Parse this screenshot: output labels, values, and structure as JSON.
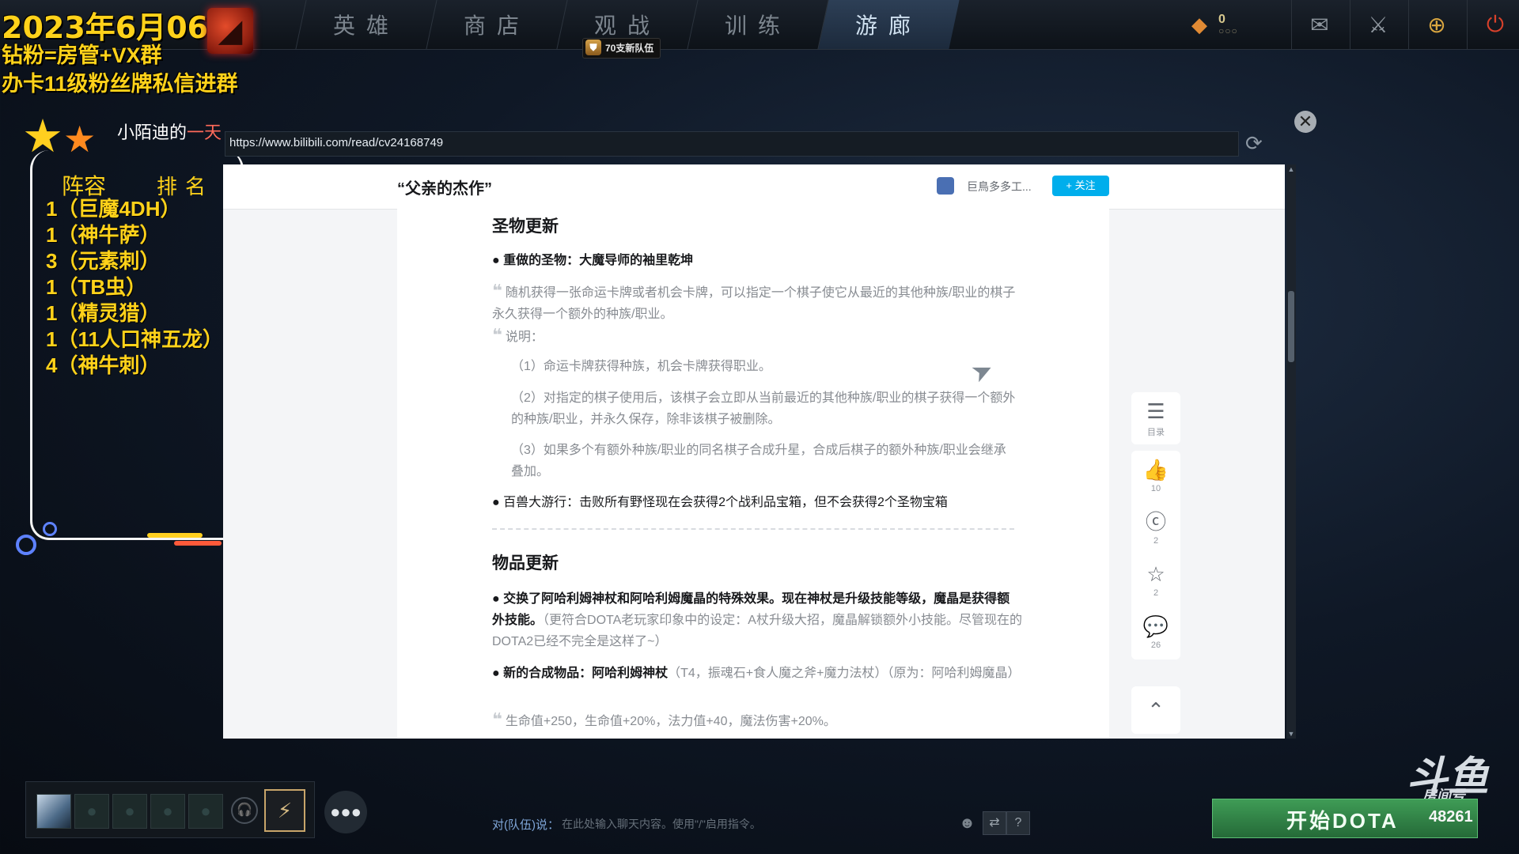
{
  "nav": {
    "tabs": [
      "英雄",
      "商店",
      "观战",
      "训练",
      "游廊"
    ],
    "active_tab": "游廊",
    "team_badge": "70支新队伍",
    "shards_count": "0",
    "shards_dots": "○○○"
  },
  "overlay": {
    "date": "2023年6月06",
    "line1": "钻粉=房管+VX群",
    "line2": "办卡11级粉丝牌私信进群",
    "streamer_prefix": "小陌迪的",
    "streamer_suffix": "一天",
    "lineup_header": "阵容",
    "rank_header": "排名",
    "lineup": [
      "1（巨魔4DH）",
      "1（神牛萨）",
      "3（元素刺）",
      "1（TB虫）",
      "1（精灵猎）",
      "1（11人口神五龙）",
      "4（神牛刺）"
    ]
  },
  "browser": {
    "url": "https://www.bilibili.com/read/cv24168749",
    "page_title": "“父亲的杰作”",
    "author": "巨鳥多多工...",
    "follow_label": "+ 关注"
  },
  "article": {
    "h1": "圣物更新",
    "p1": "● 重做的圣物：大魔导师的袖里乾坤",
    "q1": "随机获得一张命运卡牌或者机会卡牌，可以指定一个棋子使它从最近的其他种族/职业的棋子永久获得一个额外的种族/职业。",
    "q2": "说明：",
    "n1": "（1）命运卡牌获得种族，机会卡牌获得职业。",
    "n2": "（2）对指定的棋子使用后，该棋子会立即从当前最近的其他种族/职业的棋子获得一个额外的种族/职业，并永久保存，除非该棋子被删除。",
    "n3": "（3）如果多个有额外种族/职业的同名棋子合成升星，合成后棋子的额外种族/职业会继承叠加。",
    "p2": "● 百兽大游行：击败所有野怪现在会获得2个战利品宝箱，但不会获得2个圣物宝箱",
    "h2": "物品更新",
    "p3_bold": "● 交换了阿哈利姆神杖和阿哈利姆魔晶的特殊效果。现在神杖是升级技能等级，魔晶是获得额外技能。",
    "p3_note": "（更符合DOTA老玩家印象中的设定：A杖升级大招，魔晶解锁额外小技能。尽管现在的DOTA2已经不完全是这样了~）",
    "p4_bold": "● 新的合成物品：阿哈利姆神杖",
    "p4_rest": "（T4，振魂石+食人魔之斧+魔力法杖）（原为：阿哈利姆魔晶）",
    "q3": "生命值+250，生命值+20%，法力值+40，魔法伤害+20%。"
  },
  "sidebar_tools": {
    "toc_label": "目录",
    "likes": "10",
    "coins": "2",
    "favorites": "2",
    "comments": "26"
  },
  "bottom": {
    "chat_label": "对(队伍)说：",
    "chat_placeholder": "在此处输入聊天内容。使用\"/\"启用指令。",
    "help": "?",
    "play_label": "开始DOTA",
    "room_number": "48261",
    "douyu_logo": "斗鱼",
    "douyu_sub": "房间号"
  },
  "colors": {
    "accent_yellow": "#ffd21a",
    "bili_blue": "#00aeec",
    "play_green": "#3f9c56"
  }
}
